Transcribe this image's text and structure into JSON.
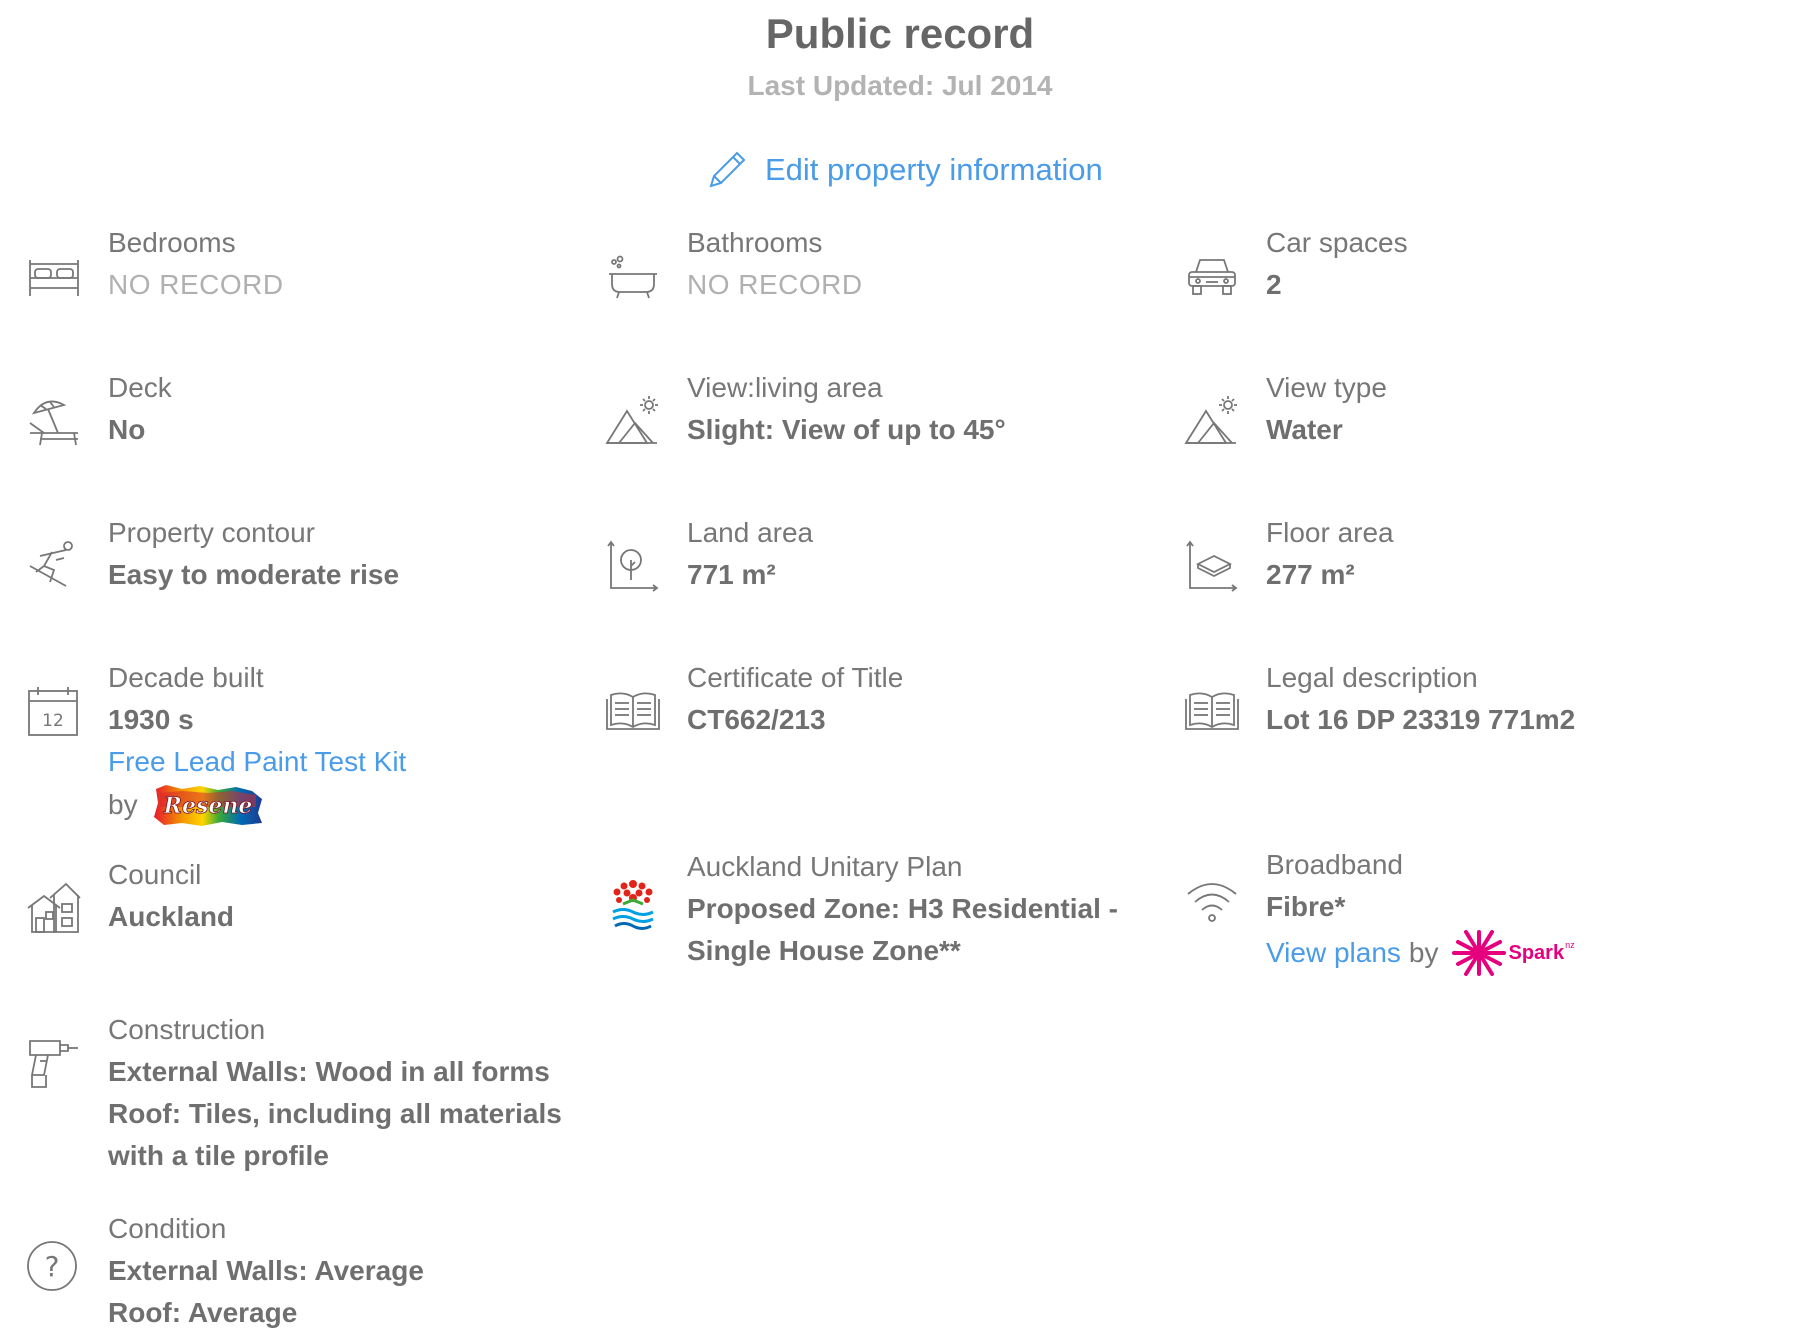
{
  "header": {
    "title": "Public record",
    "last_updated": "Last Updated: Jul 2014",
    "edit_label": "Edit property information"
  },
  "colors": {
    "link": "#4a9be8",
    "text": "#6f6f6f",
    "muted": "#b0b0b0",
    "resene": "#d7282f",
    "spark": "#e6007e"
  },
  "fields": {
    "bedrooms": {
      "label": "Bedrooms",
      "value": "NO RECORD",
      "icon": "bed-icon"
    },
    "bathrooms": {
      "label": "Bathrooms",
      "value": "NO RECORD",
      "icon": "bathtub-icon"
    },
    "car_spaces": {
      "label": "Car spaces",
      "value": "2",
      "icon": "car-icon"
    },
    "deck": {
      "label": "Deck",
      "value": "No",
      "icon": "umbrella-lounger-icon"
    },
    "view_living": {
      "label": "View:living area",
      "value": "Slight: View of up to 45°",
      "icon": "mountain-sun-icon"
    },
    "view_type": {
      "label": "View type",
      "value": "Water",
      "icon": "mountain-sun-icon"
    },
    "contour": {
      "label": "Property contour",
      "value": "Easy to moderate rise",
      "icon": "skier-icon"
    },
    "land_area": {
      "label": "Land area",
      "value": "771 m²",
      "icon": "land-area-icon"
    },
    "floor_area": {
      "label": "Floor area",
      "value": "277 m²",
      "icon": "floor-area-icon"
    },
    "decade_built": {
      "label": "Decade built",
      "value": "1930 s",
      "link": "Free Lead Paint Test Kit",
      "by": "by",
      "logo_text": "Resene",
      "icon": "calendar-icon",
      "calendar_number": "12"
    },
    "certificate": {
      "label": "Certificate of Title",
      "value": "CT662/213",
      "icon": "book-icon"
    },
    "legal": {
      "label": "Legal description",
      "value": "Lot 16 DP 23319 771m2",
      "icon": "book-icon"
    },
    "council": {
      "label": "Council",
      "value": "Auckland",
      "icon": "houses-icon"
    },
    "unitary_plan": {
      "label": "Auckland Unitary Plan",
      "value_line1": "Proposed Zone: H3 Residential -",
      "value_line2": "Single House Zone**",
      "icon": "auckland-council-logo"
    },
    "broadband": {
      "label": "Broadband",
      "value": "Fibre*",
      "link": "View plans",
      "by": "by",
      "logo_text": "Spark",
      "logo_sup": "nz",
      "icon": "wifi-icon"
    },
    "construction": {
      "label": "Construction",
      "lines": [
        "External Walls: Wood in all forms",
        "Roof: Tiles, including all materials",
        "with a tile profile"
      ],
      "icon": "drill-icon"
    },
    "condition": {
      "label": "Condition",
      "lines": [
        "External Walls: Average",
        "Roof: Average"
      ],
      "icon": "question-circle-icon"
    }
  }
}
